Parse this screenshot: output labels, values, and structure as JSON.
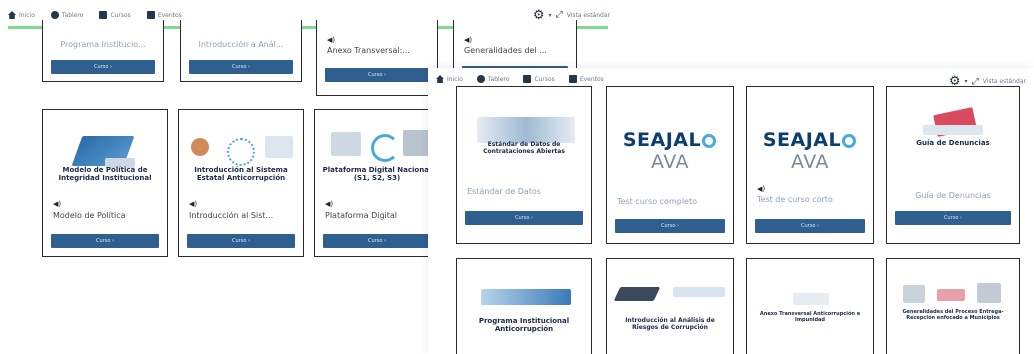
{
  "window_a": {
    "nav": [
      {
        "label": "Inicio",
        "icon": "home-icon"
      },
      {
        "label": "Tablero",
        "icon": "dashboard-icon"
      },
      {
        "label": "Cursos",
        "icon": "courses-icon"
      },
      {
        "label": "Eventos",
        "icon": "events-icon"
      }
    ],
    "view_label": "Vista estándar",
    "top_row": [
      {
        "text": "Programa Institucio...",
        "button": "Curso ›"
      },
      {
        "text": "Introducción a Anál...",
        "button": "Curso ›"
      },
      {
        "text": "Anexo Transversal:...",
        "button": "Curso ›"
      },
      {
        "text": "Generalidades del ...",
        "button": ""
      }
    ],
    "cards": [
      {
        "title": "Modelo de Política de Integridad Institucional",
        "text": "Modelo de Política",
        "button": "Curso ›"
      },
      {
        "title": "Introducción al Sistema Estatal Anticorrupción",
        "text": "Introducción al Sist...",
        "button": "Curso ›"
      },
      {
        "title": "Plataforma Digital Nacional (S1, S2, S3)",
        "text": "Plataforma Digital",
        "button": "Curso ›"
      }
    ]
  },
  "window_b": {
    "nav": [
      {
        "label": "Inicio",
        "icon": "home-icon"
      },
      {
        "label": "Tablero",
        "icon": "dashboard-icon"
      },
      {
        "label": "Cursos",
        "icon": "courses-icon"
      },
      {
        "label": "Eventos",
        "icon": "events-icon"
      }
    ],
    "view_label": "Vista estándar",
    "cards": [
      {
        "title": "Estándar de Datos de Contrataciones Abiertas",
        "text": "Estándar de Datos",
        "button": "Curso ›"
      },
      {
        "logo": "SEAJAL",
        "logo_suffix": "AVA",
        "text": "Test curso completo",
        "button": "Curso ›"
      },
      {
        "logo": "SEAJAL",
        "logo_suffix": "AVA",
        "text": "Test de curso corto",
        "button": "Curso ›"
      },
      {
        "title": "Guía de Denuncias",
        "text": "Guía de Denuncias",
        "button": "Curso ›"
      }
    ],
    "bottom_row": [
      {
        "title": "Programa Institucional Anticorrupción"
      },
      {
        "title": "Introducción al Análisis de Riesgos de Corrupción"
      },
      {
        "title": "Anexo Transversal Anticorrupción e Impunidad"
      },
      {
        "title": "Generalidades del Proceso Entrega-Recepción enfocado a Municipios"
      }
    ]
  },
  "colors": {
    "button": "#2e5f8f",
    "accent_line": "#7bdc8f",
    "title": "#1b2a4a",
    "logo": "#0d3d6e"
  }
}
